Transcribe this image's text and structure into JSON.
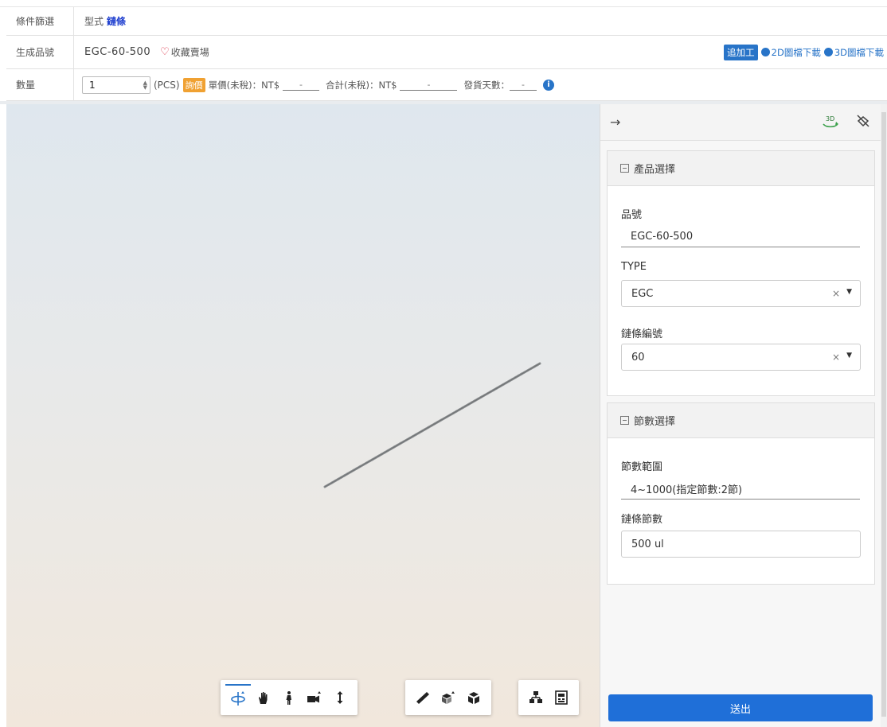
{
  "filter_row": {
    "label": "條件篩選",
    "style_label": "型式",
    "style_value": "鏈條"
  },
  "part_row": {
    "label": "生成品號",
    "part_number": "EGC-60-500",
    "favorite": "收藏賣場",
    "add_process": "追加工",
    "dl_2d": "2D圖檔下載",
    "dl_3d": "3D圖檔下載"
  },
  "qty_row": {
    "label": "數量",
    "qty": "1",
    "unit": "(PCS)",
    "ask_price": "詢價",
    "unit_price_label": "單價(未稅)：NT$",
    "unit_price_value": "-",
    "total_label": "合計(未稅)：NT$",
    "total_value": "-",
    "ship_label": "發貨天數：",
    "ship_value": "-",
    "info_glyph": "i"
  },
  "toolbar_icons": [
    "orbit-icon",
    "pan-hand-icon",
    "walk-person-icon",
    "camera-icon",
    "zoom-vertical-icon",
    "measure-ruler-icon",
    "explode-model-icon",
    "cube-view-icon",
    "structure-tree-icon",
    "properties-icon"
  ],
  "panel": {
    "section1": {
      "title": "產品選擇",
      "part_label": "品號",
      "part_value": "EGC-60-500",
      "type_label": "TYPE",
      "type_value": "EGC",
      "chain_label": "鏈條編號",
      "chain_value": "60",
      "clear_glyph": "×",
      "caret_glyph": "▼"
    },
    "section2": {
      "title": "節數選擇",
      "range_label": "節數範圍",
      "range_value": "4~1000(指定節數:2節)",
      "count_label": "鏈條節數",
      "count_value": "500 ul"
    },
    "submit": "送出",
    "back_glyph": "→",
    "badge_3d": "3D"
  },
  "colors": {
    "accent": "#2874c8",
    "submit": "#1f6fd8",
    "ask": "#f0a132",
    "heart": "#d9233a"
  }
}
